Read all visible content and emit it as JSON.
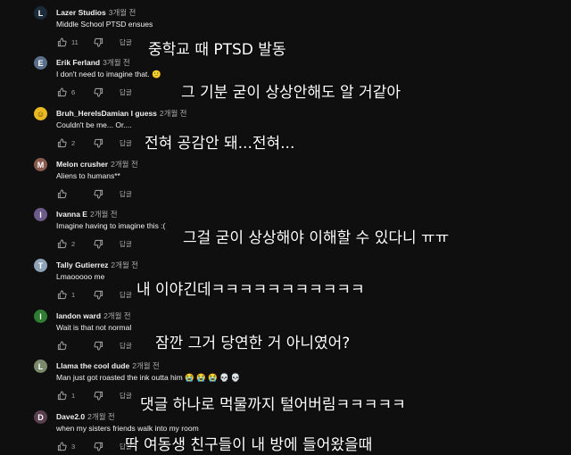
{
  "comments": [
    {
      "author": "Lazer Studios",
      "time": "3개월 전",
      "text": "Middle School PTSD ensues",
      "likes": "11",
      "reply": "답글",
      "avatar_color": "#1c2b3a",
      "avatar_letter": "L",
      "subtitle": "중학교 때 PTSD 발동"
    },
    {
      "author": "Erik Ferland",
      "time": "3개월 전",
      "text": "I don't need to imagine that. 😕",
      "likes": "6",
      "reply": "답글",
      "avatar_color": "#5a6f8a",
      "avatar_letter": "E",
      "subtitle": "그 기분 굳이 상상안해도 알 거같아"
    },
    {
      "author": "Bruh_HereIsDamian I guess",
      "time": "2개월 전",
      "text": "Couldn't be me... Or....",
      "likes": "2",
      "reply": "답글",
      "avatar_color": "#e8b923",
      "avatar_letter": "☺",
      "subtitle": "전혀 공감안 돼...전혀..."
    },
    {
      "author": "Melon crusher",
      "time": "2개월 전",
      "text": "Aliens to humans**",
      "likes": "",
      "reply": "답글",
      "avatar_color": "#8a5a4f",
      "avatar_letter": "M",
      "subtitle": ""
    },
    {
      "author": "Ivanna E",
      "time": "2개월 전",
      "text": "Imagine having to imagine this :(",
      "likes": "2",
      "reply": "답글",
      "avatar_color": "#6b5a8a",
      "avatar_letter": "I",
      "subtitle": "그걸 굳이 상상해야 이해할 수 있다니 ㅠㅠ"
    },
    {
      "author": "Tally Gutierrez",
      "time": "2개월 전",
      "text": "Lmaooooo me",
      "likes": "1",
      "reply": "답글",
      "avatar_color": "#8fa3b8",
      "avatar_letter": "T",
      "subtitle": "내 이야긴데ㅋㅋㅋㅋㅋㅋㅋㅋㅋㅋㅋ"
    },
    {
      "author": "landon ward",
      "time": "2개월 전",
      "text": "Wait is that not normal",
      "likes": "",
      "reply": "답글",
      "avatar_color": "#2e7d32",
      "avatar_letter": "l",
      "subtitle": "잠깐 그거 당연한 거 아니였어?"
    },
    {
      "author": "Llama the cool dude",
      "time": "2개월 전",
      "text": "Man just got roasted the ink outta him 😭 😭 😭 💀 💀",
      "likes": "1",
      "reply": "답글",
      "avatar_color": "#7a8a6b",
      "avatar_letter": "L",
      "subtitle": "댓글 하나로 먹물까지 털어버림ㅋㅋㅋㅋㅋ"
    },
    {
      "author": "Dave2.0",
      "time": "2개월 전",
      "text": "when my sisters friends walk into my room",
      "likes": "3",
      "reply": "답글",
      "avatar_color": "#5a3f4f",
      "avatar_letter": "D",
      "subtitle": "딱 여동생 친구들이 내 방에 들어왔을때"
    }
  ]
}
